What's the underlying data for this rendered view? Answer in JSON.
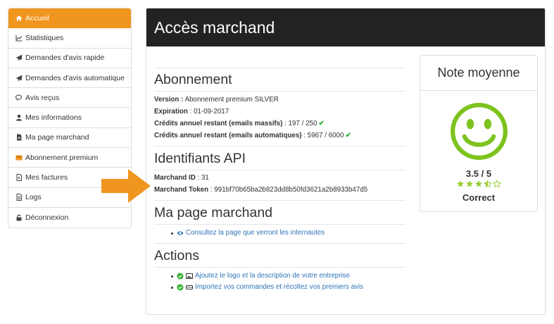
{
  "sidebar": {
    "items": [
      {
        "label": "Accueil",
        "icon": "home-icon"
      },
      {
        "label": "Statistiques",
        "icon": "chart-icon"
      },
      {
        "label": "Demandes d'avis rapide",
        "icon": "send-icon"
      },
      {
        "label": "Demandes d'avis automatique",
        "icon": "send-icon"
      },
      {
        "label": "Avis reçus",
        "icon": "comments-icon"
      },
      {
        "label": "Mes informations",
        "icon": "user-icon"
      },
      {
        "label": "Ma page marchand",
        "icon": "file-icon"
      },
      {
        "label": "Abonnement premium",
        "icon": "credit-card-icon"
      },
      {
        "label": "Mes factures",
        "icon": "pdf-icon"
      },
      {
        "label": "Logs",
        "icon": "file-text-icon"
      },
      {
        "label": "Déconnexion",
        "icon": "lock-icon"
      }
    ]
  },
  "header": {
    "title": "Accès marchand"
  },
  "abonnement": {
    "title": "Abonnement",
    "version_label": "Version :",
    "version_value": " Abonnement premium SILVER",
    "expiration_label": "Expiration",
    "expiration_value": " : 01-09-2017",
    "credits_massifs_label": "Crédits annuel restant (emails massifs)",
    "credits_massifs_value": " : 197 / 250",
    "credits_auto_label": "Crédits annuel restant (emails automatiques)",
    "credits_auto_value": " : 5967 / 6000"
  },
  "api": {
    "title": "Identifiants API",
    "id_label": "Marchand ID",
    "id_value": " : 31",
    "token_label": "Marchand Token",
    "token_value": " : 991bf70b65ba2b823dd8b50fd3621a2b8933b47d5"
  },
  "page_marchand": {
    "title": "Ma page marchand",
    "link": "Consultez la page que verront les internautes"
  },
  "actions": {
    "title": "Actions",
    "items": [
      "Ajoutez le logo et la description de votre entreprise",
      "Importez vos commandes et récoltez vos premiers avis"
    ]
  },
  "note": {
    "title": "Note moyenne",
    "score": "3.5 / 5",
    "rating": 3.5,
    "verdict": "Correct"
  },
  "colors": {
    "accent": "#f0951e",
    "header_bg": "#222222",
    "smiley": "#7dc31d",
    "star": "#9acd32",
    "link": "#2f73b8",
    "check": "#2fb12f"
  }
}
